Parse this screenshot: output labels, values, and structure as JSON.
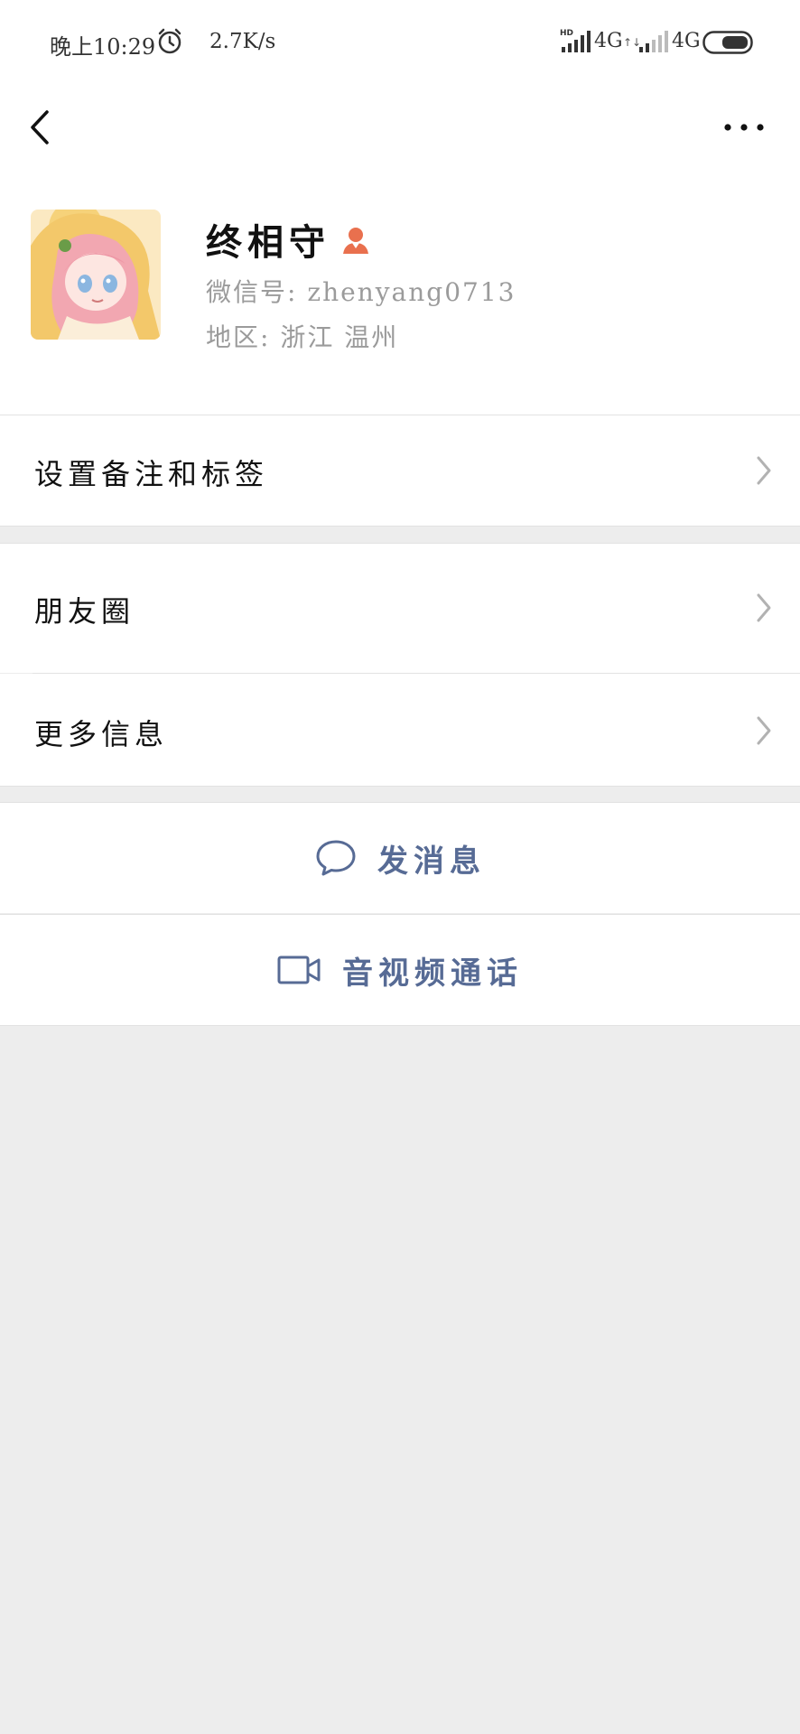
{
  "status_bar": {
    "time": "晚上10:29",
    "speed": "2.7K/s",
    "network1": "4G",
    "network2": "4G"
  },
  "nav": {
    "back_icon": "chevron-left-icon",
    "more_icon": "more-dots-icon"
  },
  "profile": {
    "name": "终相守",
    "wechat_id": "微信号: zhenyang0713",
    "region": "地区: 浙江  温州",
    "gender_icon": "female-icon"
  },
  "menu": {
    "remark_label": "设置备注和标签",
    "moments_label": "朋友圈",
    "more_info_label": "更多信息"
  },
  "actions": {
    "message_label": "发消息",
    "call_label": "音视频通话"
  },
  "colors": {
    "accent": "#576b95",
    "gender": "#e9704e",
    "background": "#ededed"
  }
}
